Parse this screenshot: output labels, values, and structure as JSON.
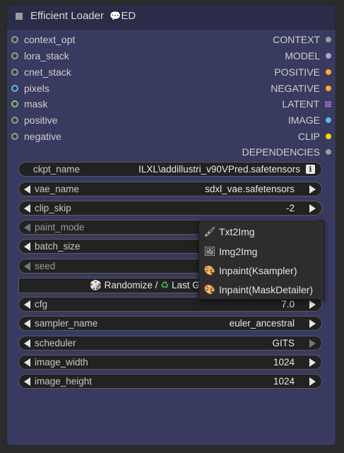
{
  "node": {
    "title": "Efficient Loader",
    "title_badge_icon": "speech-bubble-icon",
    "title_badge": "ED"
  },
  "inputs": [
    {
      "label": "context_opt",
      "color": "#9c9c9c"
    },
    {
      "label": "lora_stack",
      "color": "#9c9c9c"
    },
    {
      "label": "cnet_stack",
      "color": "#9c9c9c"
    },
    {
      "label": "pixels",
      "color": "#64b5f6"
    },
    {
      "label": "mask",
      "color": "#81c784"
    },
    {
      "label": "positive",
      "color": "#9c9c9c"
    },
    {
      "label": "negative",
      "color": "#9c9c9c"
    }
  ],
  "outputs": [
    {
      "label": "CONTEXT",
      "color": "#9c9c9c"
    },
    {
      "label": "MODEL",
      "color": "#b39ddb"
    },
    {
      "label": "POSITIVE",
      "color": "#ffa931"
    },
    {
      "label": "NEGATIVE",
      "color": "#ffa931"
    },
    {
      "label": "LATENT",
      "color": "#ff9cf9"
    },
    {
      "label": "IMAGE",
      "color": "#64b5f6"
    },
    {
      "label": "CLIP",
      "color": "#ffd500"
    },
    {
      "label": "DEPENDENCIES",
      "color": "#9c9c9c"
    }
  ],
  "widgets": {
    "ckpt_name": {
      "label": "ckpt_name",
      "value": "ILXL\\addillustri_v90VPred.safetensors"
    },
    "vae_name": {
      "label": "vae_name",
      "value": "sdxl_vae.safetensors"
    },
    "clip_skip": {
      "label": "clip_skip",
      "value": "-2"
    },
    "paint_mode": {
      "label": "paint_mode",
      "value": ""
    },
    "batch_size": {
      "label": "batch_size",
      "value": ""
    },
    "seed": {
      "label": "seed",
      "value": ""
    },
    "randomize_button": {
      "label": "Randomize / ",
      "label2": "Last G"
    },
    "cfg": {
      "label": "cfg",
      "value": "7.0"
    },
    "sampler_name": {
      "label": "sampler_name",
      "value": "euler_ancestral"
    },
    "scheduler": {
      "label": "scheduler",
      "value": "GITS"
    },
    "image_width": {
      "label": "image_width",
      "value": "1024"
    },
    "image_height": {
      "label": "image_height",
      "value": "1024"
    }
  },
  "context_menu": {
    "items": [
      {
        "label": "Txt2Img",
        "icon": "paintbrush-icon"
      },
      {
        "label": "Img2Img",
        "icon": "framed-image-icon"
      },
      {
        "label": "Inpaint(Ksampler)",
        "icon": "palette-icon"
      },
      {
        "label": "Inpaint(MaskDetailer)",
        "icon": "palette-icon"
      }
    ]
  },
  "colors": {
    "node_body": "#393a5f",
    "title_bar": "#2b2c48",
    "canvas": "#2b2b2b",
    "widget_bg": "#222222"
  }
}
